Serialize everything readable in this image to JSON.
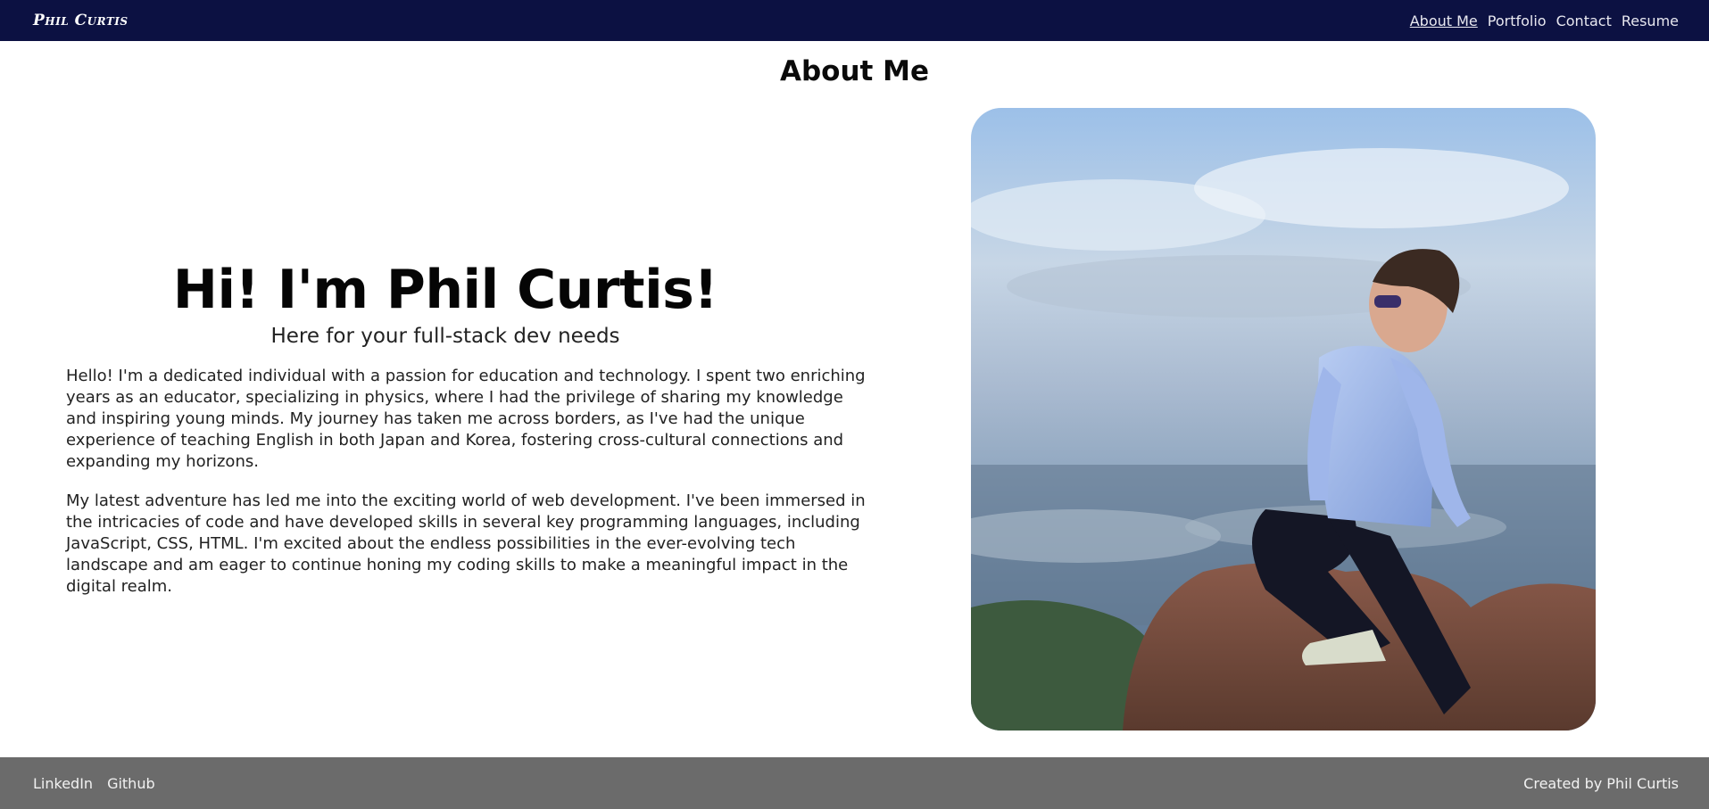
{
  "nav": {
    "brand": "Phil Curtis",
    "links": [
      "About Me",
      "Portfolio",
      "Contact",
      "Resume"
    ],
    "active": "About Me"
  },
  "about": {
    "title": "About Me",
    "heading": "Hi! I'm Phil Curtis!",
    "subheading": "Here for your full-stack dev needs",
    "paragraphs": [
      "Hello! I'm a dedicated individual with a passion for education and technology. I spent two enriching years as an educator, specializing in physics, where I had the privilege of sharing my knowledge and inspiring young minds. My journey has taken me across borders, as I've had the unique experience of teaching English in both Japan and Korea, fostering cross-cultural connections and expanding my horizons.",
      "My latest adventure has led me into the exciting world of web development. I've been immersed in the intricacies of code and have developed skills in several key programming languages, including JavaScript, CSS, HTML. I'm excited about the endless possibilities in the ever-evolving tech landscape and am eager to continue honing my coding skills to make a meaningful impact in the digital realm."
    ]
  },
  "footer": {
    "links": [
      "LinkedIn",
      "Github"
    ],
    "credit": "Created by Phil Curtis"
  },
  "colors": {
    "navbar": "#0c1142",
    "footer": "#6b6b6b"
  }
}
